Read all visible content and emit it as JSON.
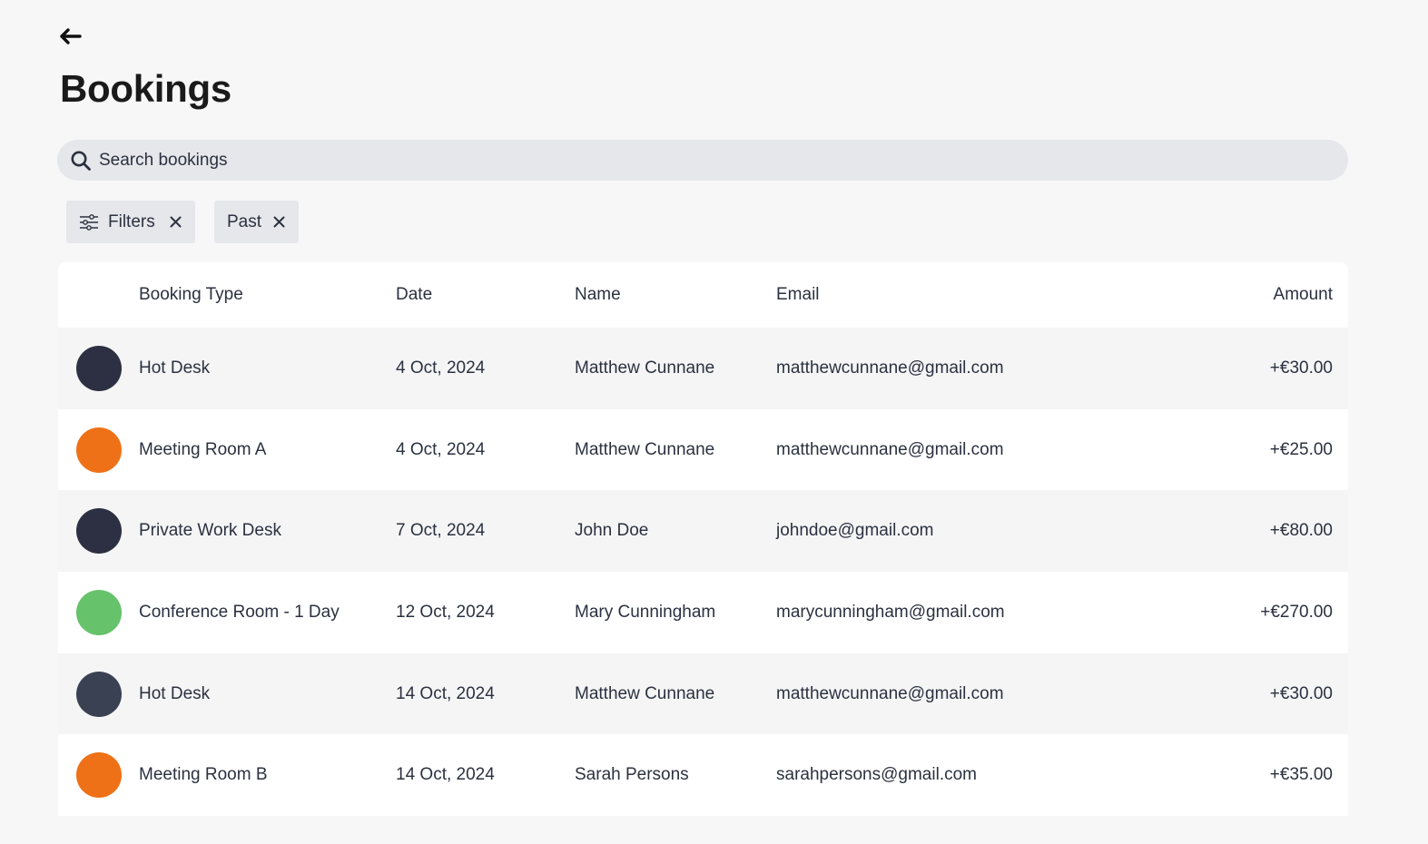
{
  "header": {
    "back_icon": "arrow-left-icon",
    "title": "Bookings"
  },
  "search": {
    "icon": "search-icon",
    "placeholder": "Search bookings",
    "value": ""
  },
  "filters": [
    {
      "label": "Filters",
      "icon": "sliders-icon",
      "close_icon": "close-icon"
    },
    {
      "label": "Past",
      "close_icon": "close-icon"
    }
  ],
  "table": {
    "columns": [
      "Booking Type",
      "Date",
      "Name",
      "Email",
      "Amount"
    ],
    "rows": [
      {
        "color": "#2c3042",
        "type": "Hot Desk",
        "date": "4 Oct, 2024",
        "name": "Matthew Cunnane",
        "email": "matthewcunnane@gmail.com",
        "amount": "+€30.00"
      },
      {
        "color": "#ef7117",
        "type": "Meeting Room A",
        "date": "4 Oct, 2024",
        "name": "Matthew Cunnane",
        "email": "matthewcunnane@gmail.com",
        "amount": "+€25.00"
      },
      {
        "color": "#2c3042",
        "type": "Private Work Desk",
        "date": "7 Oct, 2024",
        "name": "John Doe",
        "email": "johndoe@gmail.com",
        "amount": "+€80.00"
      },
      {
        "color": "#66c26b",
        "type": "Conference Room - 1 Day",
        "date": "12 Oct, 2024",
        "name": "Mary Cunningham",
        "email": "marycunningham@gmail.com",
        "amount": "+€270.00"
      },
      {
        "color": "#394153",
        "type": "Hot Desk",
        "date": "14 Oct, 2024",
        "name": "Matthew Cunnane",
        "email": "matthewcunnane@gmail.com",
        "amount": "+€30.00"
      },
      {
        "color": "#ef7117",
        "type": "Meeting Room B",
        "date": "14 Oct, 2024",
        "name": "Sarah Persons",
        "email": "sarahpersons@gmail.com",
        "amount": "+€35.00"
      }
    ]
  }
}
